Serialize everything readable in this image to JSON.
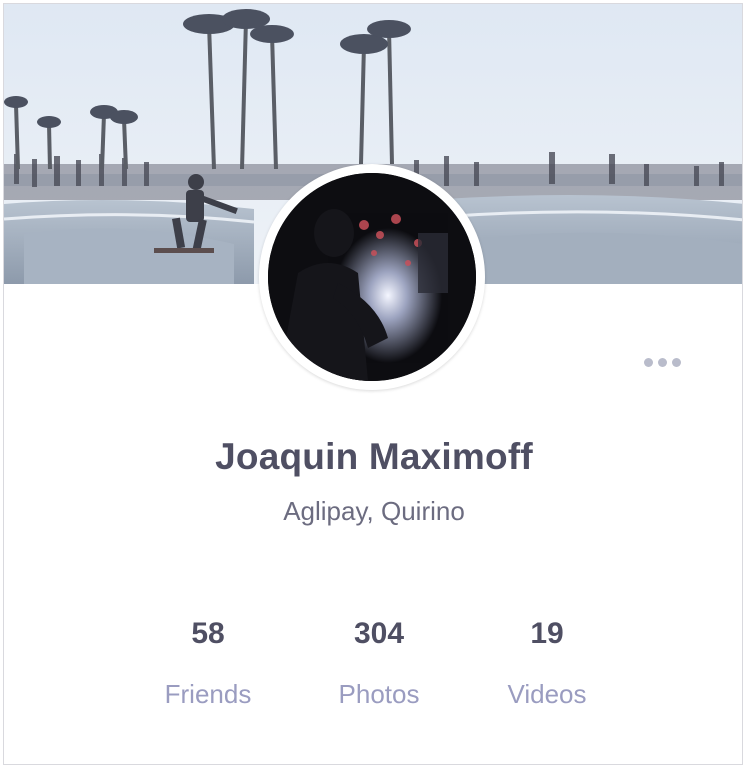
{
  "profile": {
    "name": "Joaquin Maximoff",
    "location": "Aglipay, Quirino"
  },
  "stats": {
    "friends": {
      "count": "58",
      "label": "Friends"
    },
    "photos": {
      "count": "304",
      "label": "Photos"
    },
    "videos": {
      "count": "19",
      "label": "Videos"
    }
  },
  "icons": {
    "more": "more-horizontal-icon"
  },
  "colors": {
    "name_text": "#4f4f63",
    "location_text": "#6c6c80",
    "stat_label": "#9a9cc0",
    "more_dots": "#b9bccb"
  }
}
